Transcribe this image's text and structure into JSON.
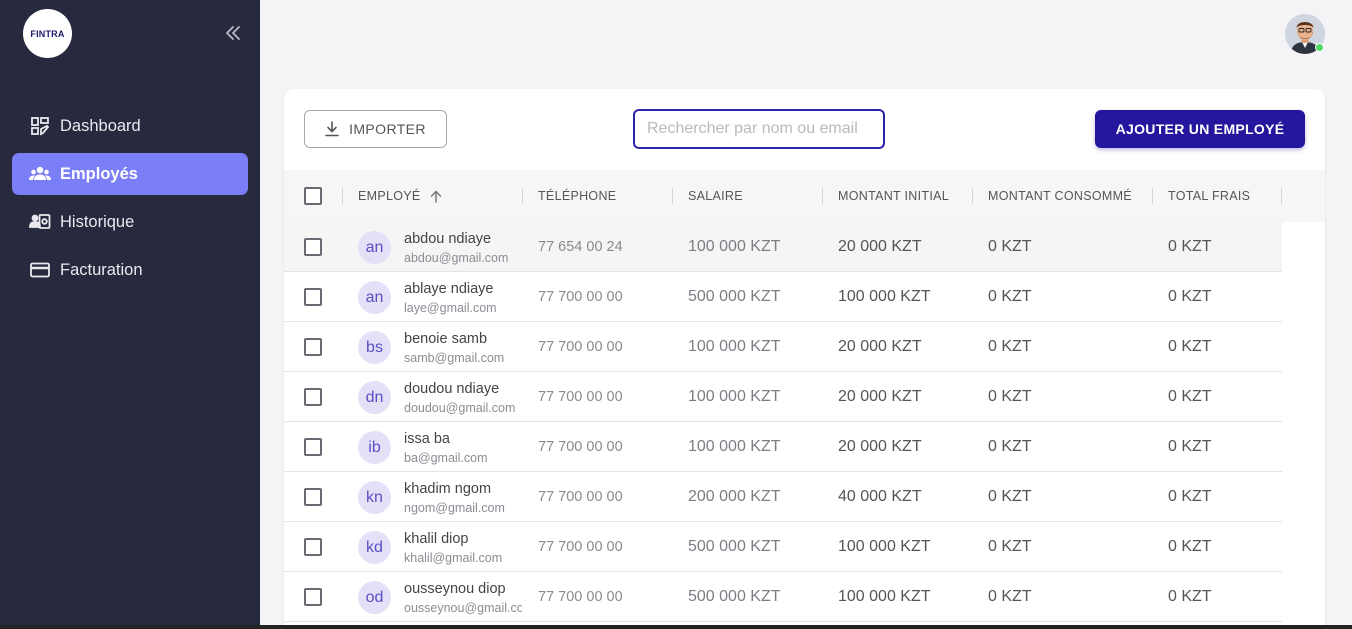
{
  "brand": {
    "logo_text": "FINTRA"
  },
  "sidebar": {
    "items": [
      {
        "label": "Dashboard",
        "icon": "dashboard-icon",
        "active": false
      },
      {
        "label": "Employés",
        "icon": "users-icon",
        "active": true
      },
      {
        "label": "Historique",
        "icon": "history-icon",
        "active": false
      },
      {
        "label": "Facturation",
        "icon": "credit-card-icon",
        "active": false
      }
    ]
  },
  "colors": {
    "sidebar_bg": "#272a3e",
    "active_nav": "#7b7ff7",
    "primary": "#24179e",
    "online": "#4cd964"
  },
  "toolbar": {
    "import_label": "IMPORTER",
    "search_placeholder": "Rechercher par nom ou email",
    "add_label": "AJOUTER UN EMPLOYÉ"
  },
  "table": {
    "headers": [
      "EMPLOYÉ",
      "TÉLÉPHONE",
      "SALAIRE",
      "MONTANT INITIAL",
      "MONTANT CONSOMMÉ",
      "TOTAL FRAIS"
    ],
    "rows": [
      {
        "initials": "an",
        "name": "abdou ndiaye",
        "email": "abdou@gmail.com",
        "phone": "77 654 00 24",
        "salary": "100 000 KZT",
        "initial": "20 000 KZT",
        "consumed": "0 KZT",
        "fees": "0 KZT"
      },
      {
        "initials": "an",
        "name": "ablaye ndiaye",
        "email": "laye@gmail.com",
        "phone": "77 700 00 00",
        "salary": "500 000 KZT",
        "initial": "100 000 KZT",
        "consumed": "0 KZT",
        "fees": "0 KZT"
      },
      {
        "initials": "bs",
        "name": "benoie samb",
        "email": "samb@gmail.com",
        "phone": "77 700 00 00",
        "salary": "100 000 KZT",
        "initial": "20 000 KZT",
        "consumed": "0 KZT",
        "fees": "0 KZT"
      },
      {
        "initials": "dn",
        "name": "doudou ndiaye",
        "email": "doudou@gmail.com",
        "phone": "77 700 00 00",
        "salary": "100 000 KZT",
        "initial": "20 000 KZT",
        "consumed": "0 KZT",
        "fees": "0 KZT"
      },
      {
        "initials": "ib",
        "name": "issa ba",
        "email": "ba@gmail.com",
        "phone": "77 700 00 00",
        "salary": "100 000 KZT",
        "initial": "20 000 KZT",
        "consumed": "0 KZT",
        "fees": "0 KZT"
      },
      {
        "initials": "kn",
        "name": "khadim ngom",
        "email": "ngom@gmail.com",
        "phone": "77 700 00 00",
        "salary": "200 000 KZT",
        "initial": "40 000 KZT",
        "consumed": "0 KZT",
        "fees": "0 KZT"
      },
      {
        "initials": "kd",
        "name": "khalil diop",
        "email": "khalil@gmail.com",
        "phone": "77 700 00 00",
        "salary": "500 000 KZT",
        "initial": "100 000 KZT",
        "consumed": "0 KZT",
        "fees": "0 KZT"
      },
      {
        "initials": "od",
        "name": "ousseynou diop",
        "email": "ousseynou@gmail.com",
        "phone": "77 700 00 00",
        "salary": "500 000 KZT",
        "initial": "100 000 KZT",
        "consumed": "0 KZT",
        "fees": "0 KZT"
      }
    ]
  }
}
